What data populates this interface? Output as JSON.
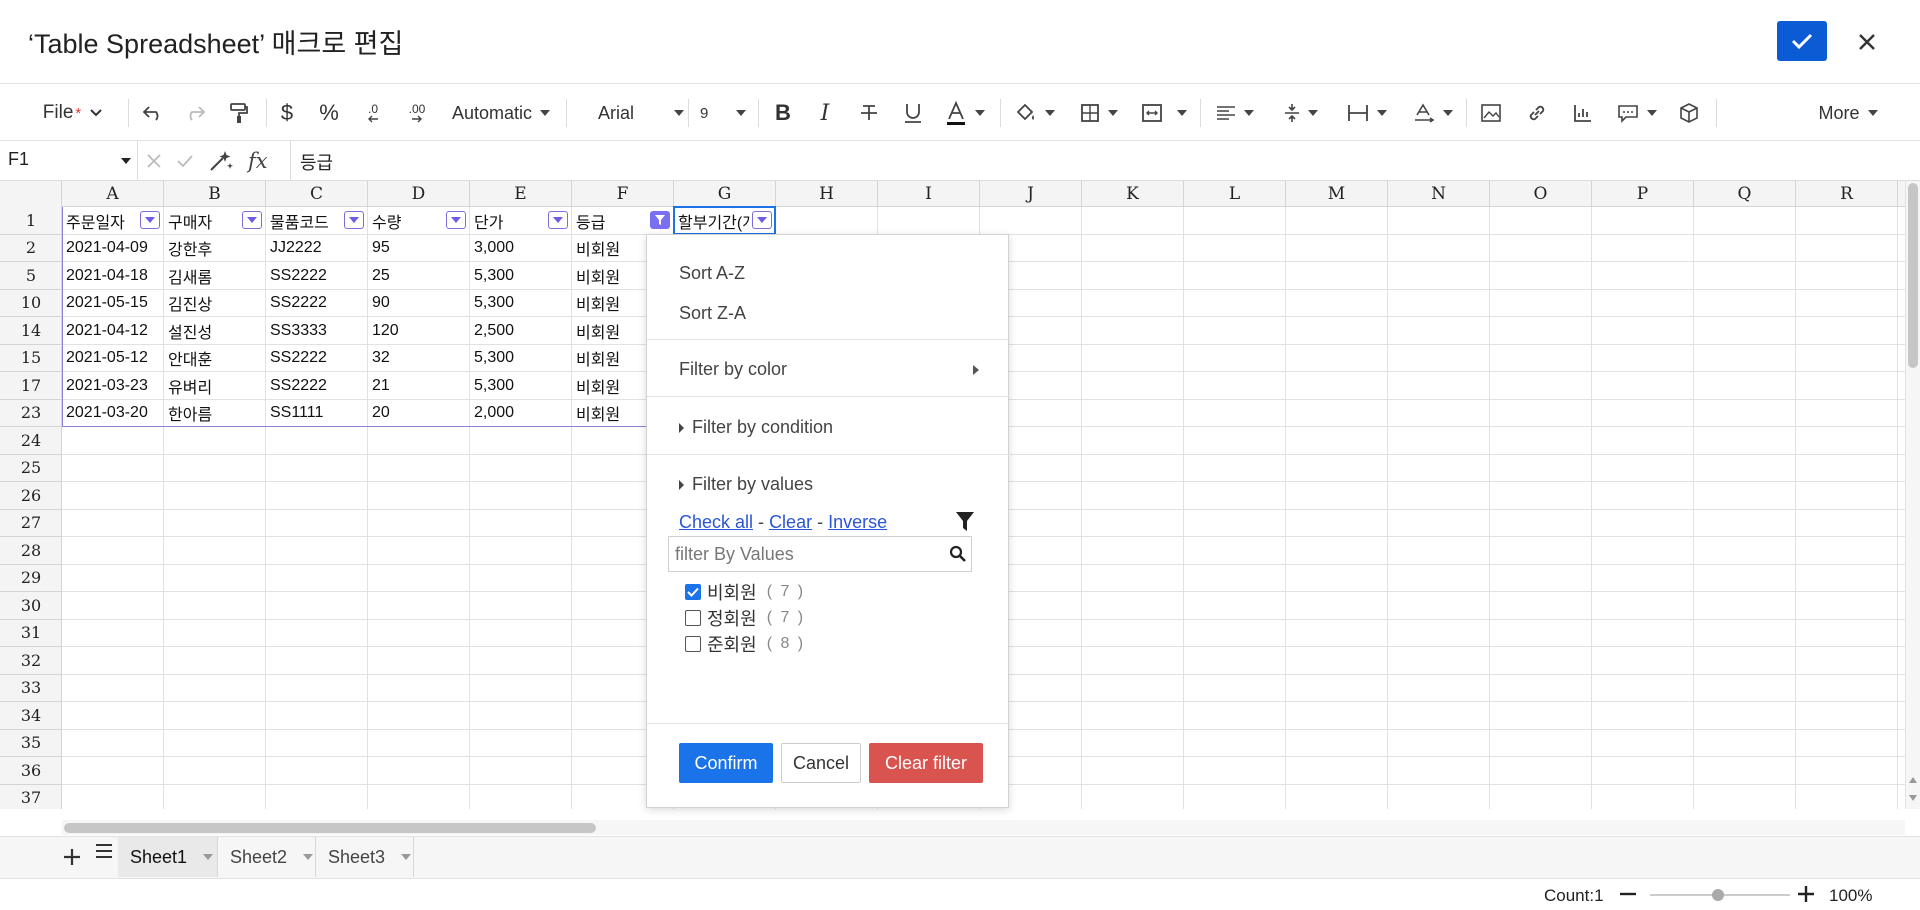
{
  "dialog": {
    "title": "‘Table Spreadsheet’ 매크로 편집"
  },
  "toolbar": {
    "file_label": "File",
    "file_modified_mark": "*",
    "number_format": "Automatic",
    "currency_symbol": "$",
    "percent_symbol": "%",
    "decrease_decimal": ".0",
    "increase_decimal": ".00",
    "font_name": "Arial",
    "font_size": "9",
    "bold": "B",
    "italic": "I",
    "more_label": "More"
  },
  "formula_bar": {
    "cell_ref": "F1",
    "fx_label": "fx",
    "value": "등급"
  },
  "grid": {
    "columns": [
      "A",
      "B",
      "C",
      "D",
      "E",
      "F",
      "G",
      "H",
      "I",
      "J",
      "K",
      "L",
      "M",
      "N",
      "O",
      "P",
      "Q",
      "R"
    ],
    "rows": [
      "1",
      "2",
      "5",
      "10",
      "14",
      "15",
      "17",
      "23",
      "24",
      "25",
      "26",
      "27",
      "28",
      "29",
      "30",
      "31",
      "32",
      "33",
      "34",
      "35",
      "36",
      "37"
    ],
    "header_row": [
      "주문일자",
      "구매자",
      "물품코드",
      "수량",
      "단가",
      "등급",
      "할부기간(개월)"
    ],
    "data_rows": [
      [
        "2021-04-09",
        "강한후",
        "JJ2222",
        "95",
        "3,000",
        "비회원"
      ],
      [
        "2021-04-18",
        "김새롬",
        "SS2222",
        "25",
        "5,300",
        "비회원"
      ],
      [
        "2021-05-15",
        "김진상",
        "SS2222",
        "90",
        "5,300",
        "비회원"
      ],
      [
        "2021-04-12",
        "설진성",
        "SS3333",
        "120",
        "2,500",
        "비회원"
      ],
      [
        "2021-05-12",
        "안대훈",
        "SS2222",
        "32",
        "5,300",
        "비회원"
      ],
      [
        "2021-03-23",
        "유벼리",
        "SS2222",
        "21",
        "5,300",
        "비회원"
      ],
      [
        "2021-03-20",
        "한아름",
        "SS1111",
        "20",
        "2,000",
        "비회원"
      ]
    ]
  },
  "filter_menu": {
    "sort_az": "Sort A-Z",
    "sort_za": "Sort Z-A",
    "filter_by_color": "Filter by color",
    "filter_by_condition": "Filter by condition",
    "filter_by_values": "Filter by values",
    "check_all": "Check all",
    "clear": "Clear",
    "inverse": "Inverse",
    "link_sep": "-",
    "search_placeholder": "filter By Values",
    "values": [
      {
        "label": "비회원",
        "count": "( 7 )",
        "checked": true
      },
      {
        "label": "정회원",
        "count": "( 7 )",
        "checked": false
      },
      {
        "label": "준회원",
        "count": "( 8 )",
        "checked": false
      }
    ],
    "confirm": "Confirm",
    "cancel": "Cancel",
    "clear_filter": "Clear filter"
  },
  "sheets": {
    "tabs": [
      "Sheet1",
      "Sheet2",
      "Sheet3"
    ],
    "active": "Sheet1"
  },
  "status": {
    "count": "Count:1",
    "zoom": "100%"
  },
  "colors": {
    "accent": "#0a5bd4",
    "primary_btn": "#1a73e8",
    "danger_btn": "#d9534f",
    "filter_accent": "#7a6ff0"
  }
}
